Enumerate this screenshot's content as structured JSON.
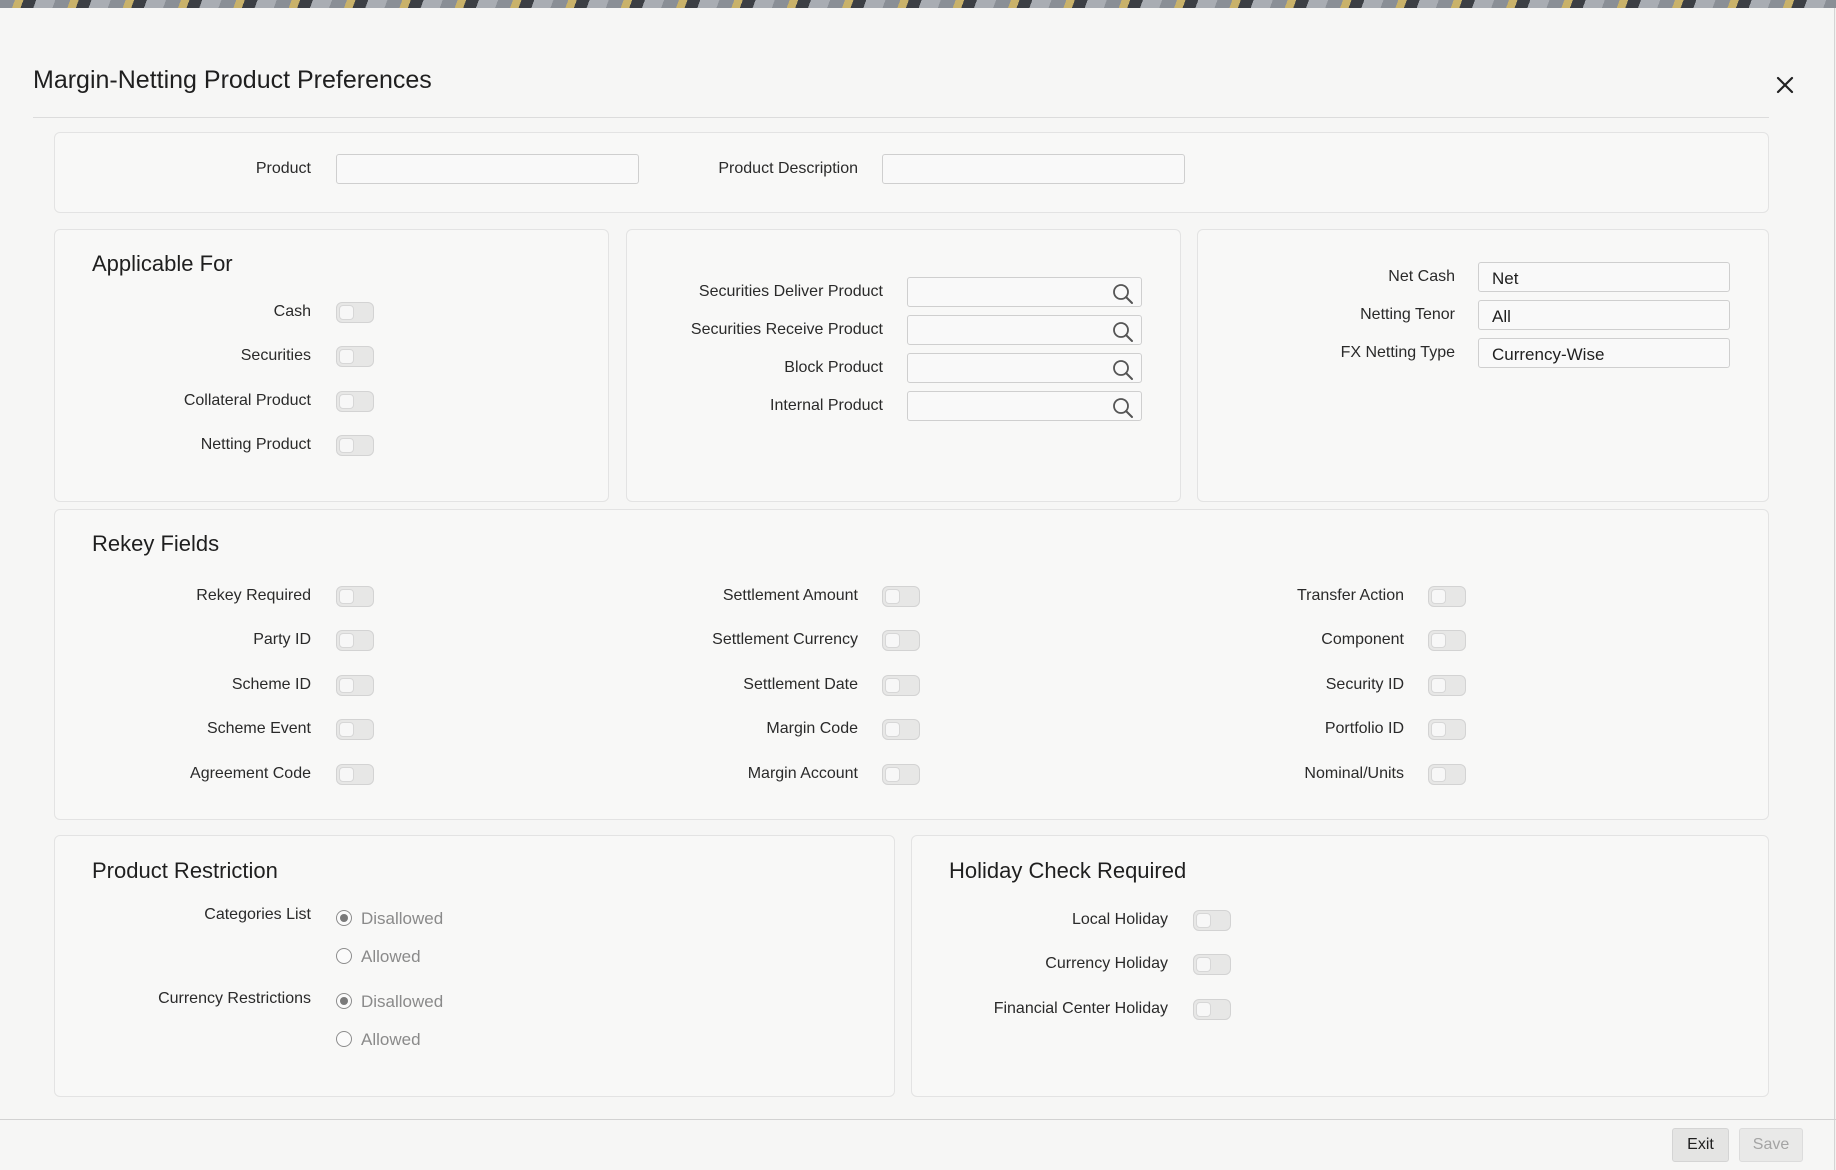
{
  "dialog": {
    "title": "Margin-Netting Product Preferences",
    "close_icon": "close-icon"
  },
  "header_fields": {
    "product_label": "Product",
    "product_value": "",
    "description_label": "Product Description",
    "description_value": ""
  },
  "applicable_for": {
    "title": "Applicable For",
    "items": [
      {
        "label": "Cash",
        "on": false
      },
      {
        "label": "Securities",
        "on": false
      },
      {
        "label": "Collateral Product",
        "on": false
      },
      {
        "label": "Netting Product",
        "on": false
      }
    ]
  },
  "products": {
    "items": [
      {
        "label": "Securities Deliver Product",
        "value": "",
        "icon": "search-icon"
      },
      {
        "label": "Securities Receive Product",
        "value": "",
        "icon": "search-icon"
      },
      {
        "label": "Block Product",
        "value": "",
        "icon": "search-icon"
      },
      {
        "label": "Internal Product",
        "value": "",
        "icon": "search-icon"
      }
    ]
  },
  "netting": {
    "items": [
      {
        "label": "Net Cash",
        "value": "Net"
      },
      {
        "label": "Netting Tenor",
        "value": "All"
      },
      {
        "label": "FX Netting Type",
        "value": "Currency-Wise"
      }
    ]
  },
  "rekey": {
    "title": "Rekey Fields",
    "col1": [
      {
        "label": "Rekey Required",
        "on": false
      },
      {
        "label": "Party ID",
        "on": false
      },
      {
        "label": "Scheme ID",
        "on": false
      },
      {
        "label": "Scheme Event",
        "on": false
      },
      {
        "label": "Agreement Code",
        "on": false
      }
    ],
    "col2": [
      {
        "label": "Settlement Amount",
        "on": false
      },
      {
        "label": "Settlement Currency",
        "on": false
      },
      {
        "label": "Settlement Date",
        "on": false
      },
      {
        "label": "Margin Code",
        "on": false
      },
      {
        "label": "Margin Account",
        "on": false
      }
    ],
    "col3": [
      {
        "label": "Transfer Action",
        "on": false
      },
      {
        "label": "Component",
        "on": false
      },
      {
        "label": "Security ID",
        "on": false
      },
      {
        "label": "Portfolio ID",
        "on": false
      },
      {
        "label": "Nominal/Units",
        "on": false
      }
    ]
  },
  "restriction": {
    "title": "Product Restriction",
    "categories_label": "Categories List",
    "categories_options": [
      "Disallowed",
      "Allowed"
    ],
    "categories_selected": "Disallowed",
    "currency_label": "Currency Restrictions",
    "currency_options": [
      "Disallowed",
      "Allowed"
    ],
    "currency_selected": "Disallowed"
  },
  "holiday": {
    "title": "Holiday Check Required",
    "items": [
      {
        "label": "Local Holiday",
        "on": false
      },
      {
        "label": "Currency Holiday",
        "on": false
      },
      {
        "label": "Financial Center Holiday",
        "on": false
      }
    ]
  },
  "footer": {
    "exit_label": "Exit",
    "save_label": "Save"
  }
}
